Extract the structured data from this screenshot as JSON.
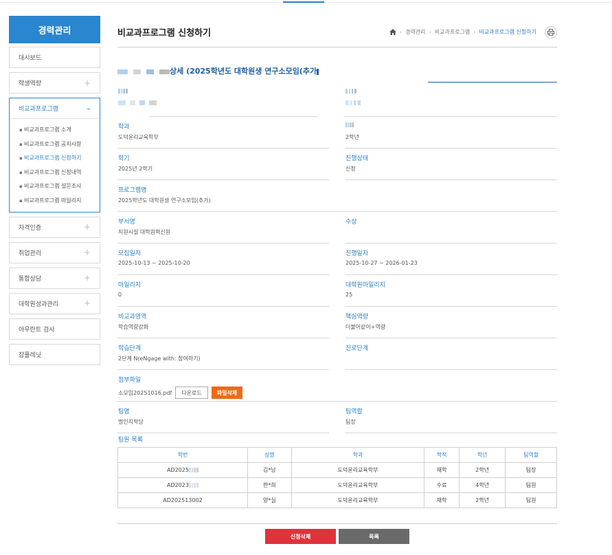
{
  "sidebar": {
    "title": "경력관리",
    "items_top": [
      {
        "label": "대시보드",
        "expandable": false
      },
      {
        "label": "학생역량",
        "expandable": true
      }
    ],
    "open_section": {
      "label": "비교과프로그램",
      "sub_items": [
        {
          "label": "비교과프로그램 소개"
        },
        {
          "label": "비교과프로그램 공지사항"
        },
        {
          "label": "비교과프로그램 신청하기",
          "active": true
        },
        {
          "label": "비교과프로그램 신청내역"
        },
        {
          "label": "비교과프로그램 설문조사"
        },
        {
          "label": "비교과프로그램 마일리지"
        }
      ]
    },
    "items_bottom": [
      {
        "label": "자격인증",
        "expandable": true
      },
      {
        "label": "취업관리",
        "expandable": true
      },
      {
        "label": "통합상담",
        "expandable": true
      },
      {
        "label": "대학원성과관리",
        "expandable": true
      },
      {
        "label": "아우란트 검사",
        "expandable": false
      },
      {
        "label": "잡플레닛",
        "expandable": false
      }
    ]
  },
  "header": {
    "title": "비교과프로그램 신청하기",
    "breadcrumb": [
      "경력관리",
      "비교과프로그램",
      "비교과프로그램 신청하기"
    ]
  },
  "detail": {
    "title_suffix": "상세 (2025학년도 대학원생 연구소모임(추가",
    "fields": {
      "department": {
        "label": "학과",
        "value": "도덕윤리교육학부"
      },
      "grade": {
        "value": "2학년"
      },
      "semester": {
        "label": "학기",
        "value": "2025년 2학기"
      },
      "status": {
        "label": "진행상태",
        "value": "신청"
      },
      "program_name": {
        "label": "프로그램명",
        "value": "2025학년도 대학원생 연구소모임(추가)"
      },
      "dept_name": {
        "label": "부서명",
        "value": "지원시설 대학원혁신원"
      },
      "award": {
        "label": "수상",
        "value": ""
      },
      "recruit_period": {
        "label": "모집일자",
        "value": "2025-10-13 ~ 2025-10-20"
      },
      "run_period": {
        "label": "진행일자",
        "value": "2025-10-27 ~ 2026-01-23"
      },
      "mileage": {
        "label": "마일리지",
        "value": "0"
      },
      "grad_mileage": {
        "label": "대학원마일리지",
        "value": "25"
      },
      "area": {
        "label": "비교과영역",
        "value": "학습역량강화"
      },
      "core_competency": {
        "label": "핵심역량",
        "value": "더불어같이+역량"
      },
      "learning_stage": {
        "label": "학습단계",
        "value": "2단계 N(eNgage with: 참여하기)"
      },
      "career_stage": {
        "label": "진로단계",
        "value": ""
      },
      "attachment": {
        "label": "첨부파일",
        "file_name": "소모임20251016.pdf",
        "download_label": "다운로드",
        "delete_label": "파일삭제"
      },
      "team_name": {
        "label": "팀명",
        "value": "명인지학당"
      },
      "team_role": {
        "label": "팀역할",
        "value": "팀장"
      }
    }
  },
  "members": {
    "label": "팀원 목록",
    "columns": [
      "학번",
      "성명",
      "학과",
      "학적",
      "학년",
      "팀역할"
    ],
    "rows": [
      [
        "AD2025",
        "김*남",
        "도덕윤리교육학부",
        "재학",
        "2학년",
        "팀장"
      ],
      [
        "AD2023",
        "한*희",
        "도덕윤리교육학부",
        "수료",
        "4학년",
        "팀원"
      ],
      [
        "AD202513002",
        "양*실",
        "도덕윤리교육학부",
        "재학",
        "2학년",
        "팀원"
      ]
    ]
  },
  "actions": {
    "cancel_label": "신청삭제",
    "list_label": "목록"
  }
}
